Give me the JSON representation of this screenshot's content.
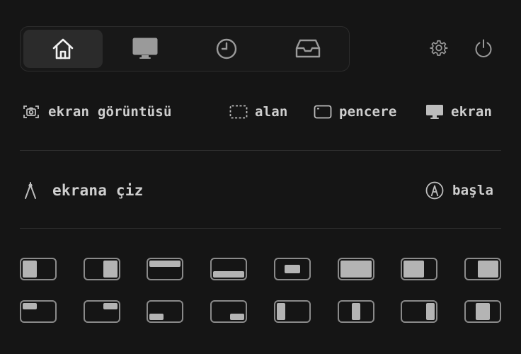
{
  "tabs": [
    {
      "name": "home",
      "icon": "home-icon",
      "active": true
    },
    {
      "name": "display",
      "icon": "monitor-icon",
      "active": false
    },
    {
      "name": "history",
      "icon": "clock-icon",
      "active": false
    },
    {
      "name": "inbox",
      "icon": "inbox-tray-icon",
      "active": false
    }
  ],
  "header_icons": {
    "settings": "gear-icon",
    "power": "power-icon"
  },
  "screenshot": {
    "label": "ekran görüntüsü",
    "icon": "camera-icon",
    "options": [
      {
        "label": "alan",
        "icon": "dashed-area-icon"
      },
      {
        "label": "pencere",
        "icon": "window-icon"
      },
      {
        "label": "ekran",
        "icon": "monitor-icon"
      }
    ]
  },
  "draw": {
    "label": "ekrana çiz",
    "icon": "compass-icon",
    "start_label": "başla",
    "start_icon": "pen-circle-icon"
  },
  "window_layouts": {
    "row1": [
      "left-half",
      "right-half",
      "top-half",
      "bottom-half",
      "center-small",
      "maximize",
      "left-two-thirds",
      "right-two-thirds"
    ],
    "row2": [
      "top-left-quarter",
      "top-right-quarter",
      "bottom-left-quarter",
      "bottom-right-quarter",
      "left-third",
      "center-third",
      "right-third",
      "center-column"
    ]
  },
  "colors": {
    "background": "#151515",
    "text": "#cfcfcf",
    "active_tab": "#2b2b2b",
    "layout_fill": "#b4b4b4"
  }
}
